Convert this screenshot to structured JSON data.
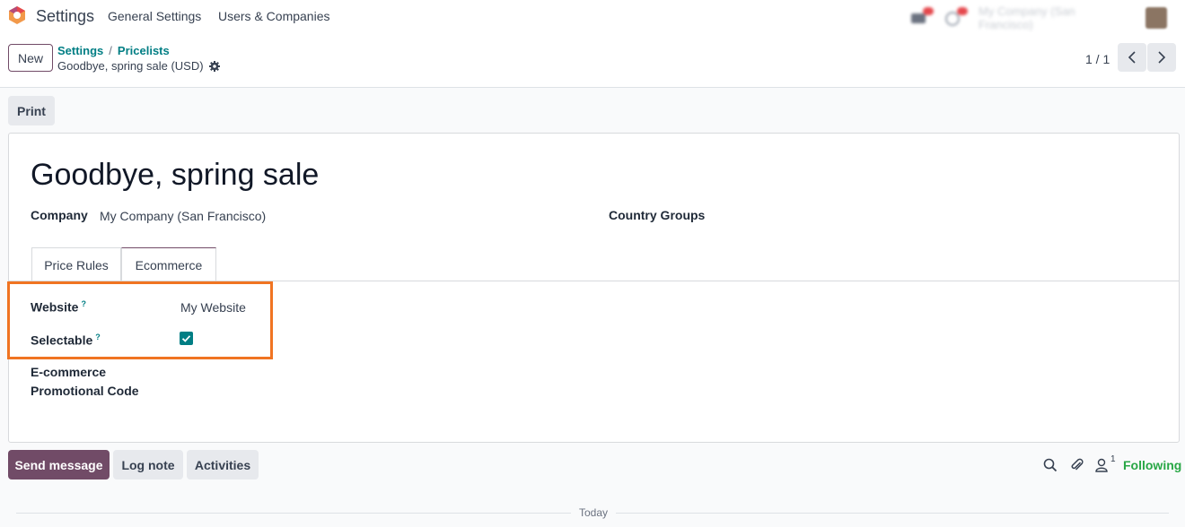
{
  "navbar": {
    "app_title": "Settings",
    "menus": [
      "General Settings",
      "Users & Companies"
    ],
    "company_switcher": "My Company (San Francisco)"
  },
  "control_panel": {
    "new_label": "New",
    "breadcrumb": [
      "Settings",
      "Pricelists"
    ],
    "record_name": "Goodbye, spring sale (USD)",
    "pager_value": "1 / 1"
  },
  "actions": {
    "print_label": "Print"
  },
  "form": {
    "title": "Goodbye, spring sale",
    "company_label": "Company",
    "company_value": "My Company (San Francisco)",
    "country_groups_label": "Country Groups",
    "tabs": [
      {
        "label": "Price Rules",
        "active": false
      },
      {
        "label": "Ecommerce",
        "active": true
      }
    ],
    "website_label": "Website",
    "website_value": "My Website",
    "selectable_label": "Selectable",
    "selectable_checked": true,
    "ecommerce_label_line1": "E-commerce",
    "ecommerce_label_line2": "Promotional Code",
    "help_marker": "?"
  },
  "chatter": {
    "send_message_label": "Send message",
    "log_note_label": "Log note",
    "activities_label": "Activities",
    "follower_count": "1",
    "following_label": "Following",
    "date_separator": "Today"
  },
  "colors": {
    "brand": "#714b67",
    "link": "#017e84",
    "following": "#28a745",
    "highlight": "#f07422"
  }
}
